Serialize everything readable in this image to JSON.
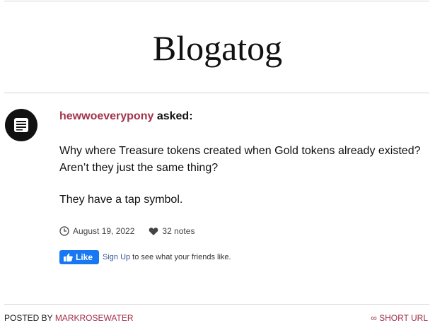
{
  "blog": {
    "title": "Blogatog"
  },
  "post": {
    "asker": "hewwoeverypony",
    "asked_label": "asked:",
    "question": "Why where Treasure tokens created when Gold tokens already existed? Aren’t they just the same thing?",
    "answer": "They have a tap symbol.",
    "date": "August 19, 2022",
    "notes": "32 notes"
  },
  "facebook": {
    "like_label": "Like",
    "signup_label": "Sign Up",
    "signup_text": "to see what your friends like."
  },
  "footer": {
    "posted_by_label": "POSTED BY",
    "author": "MARKROSEWATER",
    "short_url_label": "∞ SHORT URL"
  },
  "colors": {
    "accent": "#a2324a",
    "facebook_blue": "#1877f2",
    "divider": "#d4d4d4"
  }
}
